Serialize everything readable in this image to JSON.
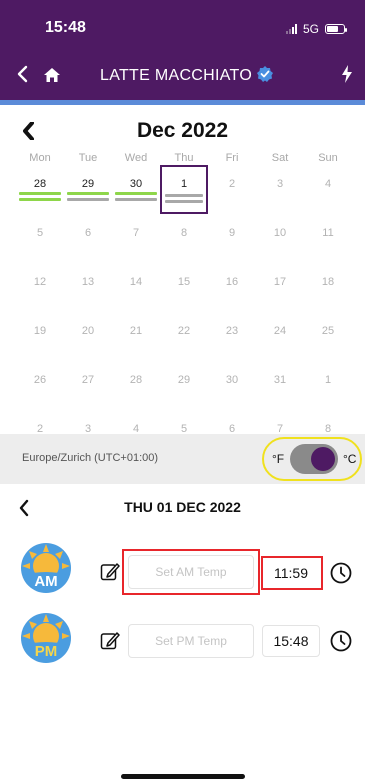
{
  "status_bar": {
    "time": "15:48",
    "network": "5G"
  },
  "nav": {
    "title": "LATTE MACCHIATO",
    "icons": [
      "back-icon",
      "home-icon",
      "verified-icon",
      "bolt-icon"
    ]
  },
  "calendar": {
    "title": "Dec 2022",
    "weekdays": [
      "Mon",
      "Tue",
      "Wed",
      "Thu",
      "Fri",
      "Sat",
      "Sun"
    ],
    "weeks": [
      [
        "28",
        "29",
        "30",
        "1",
        "2",
        "3",
        "4"
      ],
      [
        "5",
        "6",
        "7",
        "8",
        "9",
        "10",
        "11"
      ],
      [
        "12",
        "13",
        "14",
        "15",
        "16",
        "17",
        "18"
      ],
      [
        "19",
        "20",
        "21",
        "22",
        "23",
        "24",
        "25"
      ],
      [
        "26",
        "27",
        "28",
        "29",
        "30",
        "31",
        "1"
      ],
      [
        "2",
        "3",
        "4",
        "5",
        "6",
        "7",
        "8"
      ]
    ],
    "selected": "1",
    "colors": {
      "green": "#8ed64a",
      "gray": "#a8a8a8",
      "selected_border": "#4e1a63"
    },
    "indicators": [
      {
        "day": "28",
        "bars": [
          "green",
          "green"
        ]
      },
      {
        "day": "29",
        "bars": [
          "green",
          "gray"
        ]
      },
      {
        "day": "30",
        "bars": [
          "green",
          "gray"
        ]
      },
      {
        "day": "1",
        "bars": [
          "gray",
          "gray"
        ]
      }
    ]
  },
  "timezone": {
    "label": "Europe/Zurich (UTC+01:00)"
  },
  "units": {
    "fahrenheit": "°F",
    "celsius": "°C",
    "selected": "°C"
  },
  "day_header": {
    "title": "THU 01 DEC 2022"
  },
  "readings": {
    "am": {
      "badge": "AM",
      "placeholder": "Set AM Temp",
      "value": "",
      "time": "11:59"
    },
    "pm": {
      "badge": "PM",
      "placeholder": "Set PM Temp",
      "value": "",
      "time": "15:48"
    }
  },
  "accent_colors": {
    "header": "#4e1a63",
    "highlight_yellow": "#f0e11e",
    "highlight_red": "#e8262b",
    "divider_blue": "#5b8bd8"
  }
}
